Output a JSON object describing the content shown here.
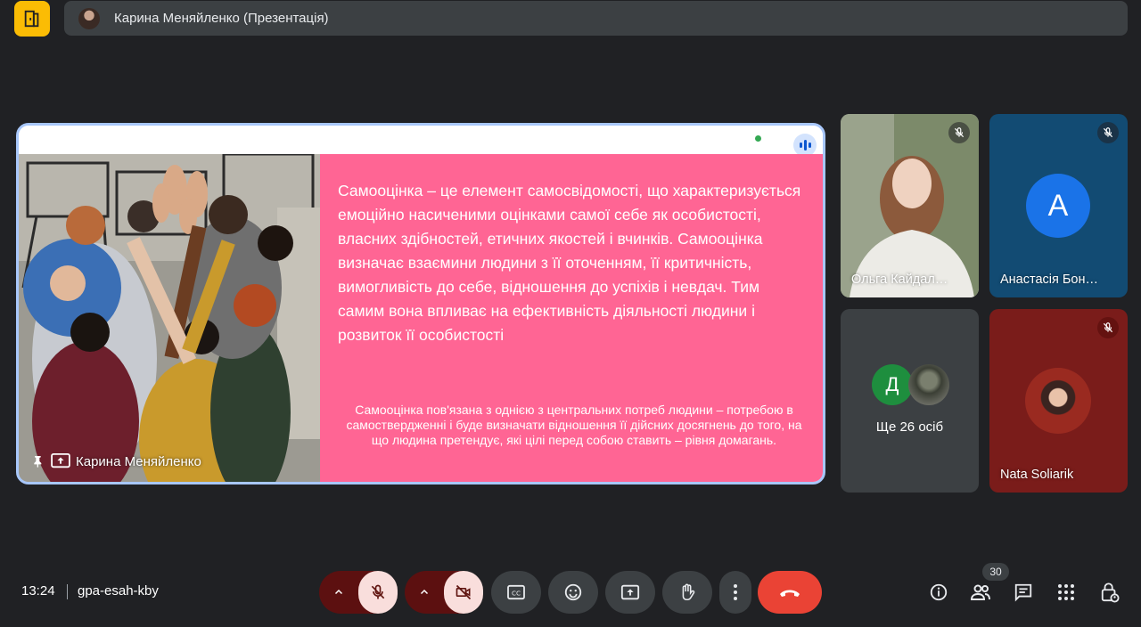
{
  "header": {
    "presenter_title": "Карина Меняйленко (Презентація)"
  },
  "slide": {
    "main_text": "Самооцінка – це елемент самосвідомості, що характеризується емоційно насиченими оцінками самої себе як особистості, власних здібностей, етичних якостей і вчинків. Самооцінка визначає взаємини людини з її оточенням, її критичність, вимогливість до себе, відношення до успіхів і невдач. Тим самим вона впливає на ефективність діяльності людини і розвиток її особистості",
    "sub_text": "Самооцінка пов'язана з однією з центральних потреб людини – потребою в самоствердженні і буде визначати відношення її дійсних досягнень до того, на що людина претендує, які цілі перед собою ставить – рівня домагань.",
    "presenter_name": "Карина Меняйленко"
  },
  "participants": [
    {
      "name": "Ольга Кайдал…",
      "muted": true
    },
    {
      "name": "Анастасія Бон…",
      "initial": "A",
      "muted": true
    },
    {
      "initial": "Д",
      "others_label": "Ще 26 осіб"
    },
    {
      "name": "Nata Soliarik",
      "muted": true
    }
  ],
  "footer": {
    "time": "13:24",
    "meeting_code": "gpa-esah-kby",
    "participant_count": "30"
  },
  "colors": {
    "accent_border": "#a8c7fa",
    "slide_pink": "#ff6594",
    "hangup_red": "#ea4335",
    "logo_yellow": "#fbbc04"
  }
}
